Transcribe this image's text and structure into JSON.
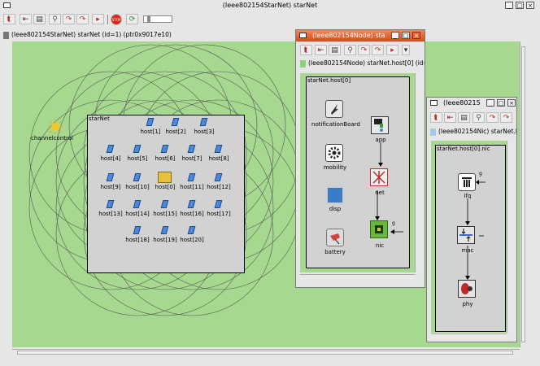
{
  "main_window": {
    "title": "(Ieee802154StarNet) starNet",
    "path": "(Ieee802154StarNet) starNet (id=1) (ptr0x9017e10)",
    "module_label": "starNet",
    "channel_control_label": "channelcontrol",
    "toolbar": [
      "back-icon",
      "up-icon",
      "module-icon",
      "find-icon",
      "run-icon",
      "fast-icon",
      "express-icon",
      "stop-icon",
      "refresh-icon"
    ],
    "stop_label": "STOP",
    "hosts": [
      "host[1]",
      "host[2]",
      "host[3]",
      "host[4]",
      "host[5]",
      "host[6]",
      "host[7]",
      "host[8]",
      "host[9]",
      "host[10]",
      "host[0]",
      "host[11]",
      "host[12]",
      "host[13]",
      "host[14]",
      "host[15]",
      "host[16]",
      "host[17]",
      "host[18]",
      "host[19]",
      "host[20]"
    ]
  },
  "node_window": {
    "title": "(Ieee802154Node) sta",
    "path": "(Ieee802154Node) starNet.host[0] (id=",
    "module_label": "starNet.host[0]",
    "modules": [
      "notificationBoard",
      "mobility",
      "disp",
      "battery",
      "app",
      "net",
      "nic"
    ],
    "gate_label": "g"
  },
  "nic_window": {
    "title": "(Ieee80215",
    "path": "(Ieee802154Nic) starNet.h",
    "module_label": "starNet.host[0].nic",
    "modules": [
      "ifq",
      "mac",
      "phy"
    ],
    "gate_label": "g"
  },
  "colors": {
    "canvas_green": "#a6d98f",
    "module_gray": "#d2d2d2",
    "active_title": "#e0602e"
  }
}
